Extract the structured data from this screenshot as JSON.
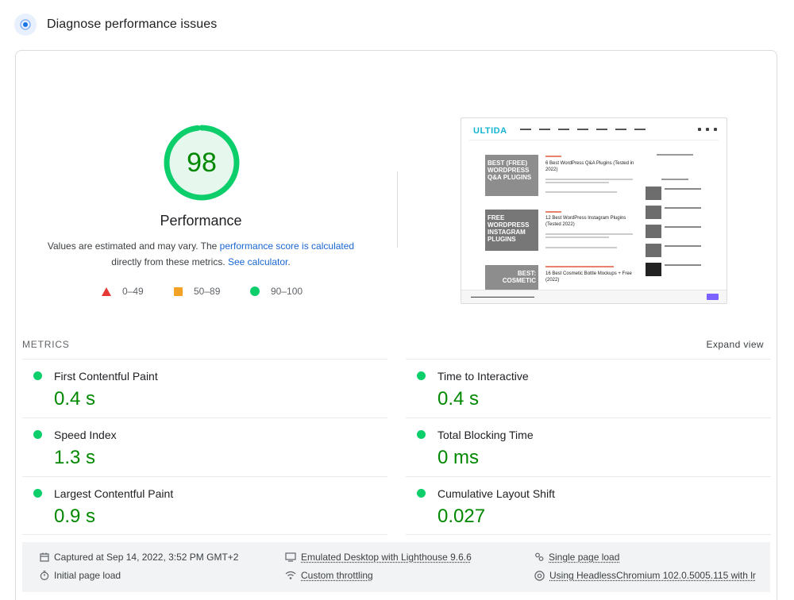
{
  "header": {
    "title": "Diagnose performance issues",
    "icon": "pulse-icon"
  },
  "score": {
    "value": "98",
    "fraction": 0.98,
    "color": "#0cce6b",
    "label": "Performance"
  },
  "description": {
    "prefix": "Values are estimated and may vary. The ",
    "link1": "performance score is calculated",
    "middle": " directly from these metrics. ",
    "link2": "See calculator",
    "suffix": "."
  },
  "legend": [
    {
      "range": "0–49",
      "icon": "triangle-icon",
      "color": "#e53935"
    },
    {
      "range": "50–89",
      "icon": "square-icon",
      "color": "#f4a223"
    },
    {
      "range": "90–100",
      "icon": "circle-icon",
      "color": "#0cce6b"
    }
  ],
  "screenshot": {
    "logo": "ULTIDA",
    "posts": [
      {
        "image_text": "BEST (FREE) WORDPRESS Q&A PLUGINS",
        "title": "6 Best WordPress Q&A Plugins (Tested in 2022)"
      },
      {
        "image_text": "FREE WORDPRESS INSTAGRAM PLUGINS",
        "title": "12 Best WordPress Instagram Plugins (Tested 2022)"
      },
      {
        "image_text": "BEST: COSMETIC",
        "title": "16 Best Cosmetic Bottle Mockups + Free (2022)"
      }
    ]
  },
  "metrics": {
    "label": "METRICS",
    "expand": "Expand view",
    "items": [
      {
        "name": "First Contentful Paint",
        "value": "0.4 s"
      },
      {
        "name": "Time to Interactive",
        "value": "0.4 s"
      },
      {
        "name": "Speed Index",
        "value": "1.3 s"
      },
      {
        "name": "Total Blocking Time",
        "value": "0 ms"
      },
      {
        "name": "Largest Contentful Paint",
        "value": "0.9 s"
      },
      {
        "name": "Cumulative Layout Shift",
        "value": "0.027"
      }
    ]
  },
  "footer": {
    "captured": "Captured at Sep 14, 2022, 3:52 PM GMT+2",
    "initial": "Initial page load",
    "emulated": "Emulated Desktop with Lighthouse 9.6.6",
    "throttling": "Custom throttling",
    "single": "Single page load",
    "browser": "Using HeadlessChromium 102.0.5005.115 with lr"
  }
}
